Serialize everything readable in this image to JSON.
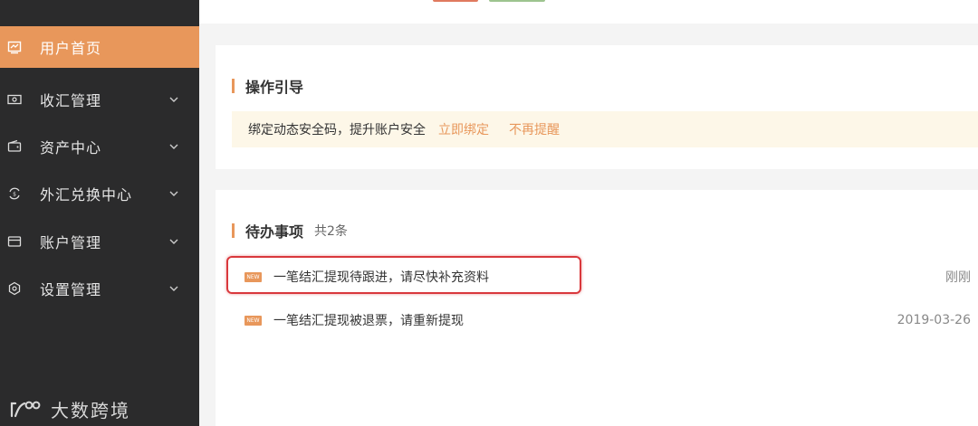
{
  "sidebar": {
    "items": [
      {
        "label": "用户首页",
        "icon": "chart-icon",
        "active": true
      },
      {
        "label": "收汇管理",
        "icon": "money-icon"
      },
      {
        "label": "资产中心",
        "icon": "wallet-icon"
      },
      {
        "label": "外汇兑换中心",
        "icon": "exchange-icon"
      },
      {
        "label": "账户管理",
        "icon": "card-icon"
      },
      {
        "label": "设置管理",
        "icon": "gear-icon"
      }
    ],
    "brand": {
      "logo": "1688-logo",
      "text": "大数跨境"
    }
  },
  "guide": {
    "title": "操作引导",
    "notice_text": "绑定动态安全码，提升账户安全",
    "bind_link": "立即绑定",
    "dismiss_link": "不再提醒"
  },
  "todo": {
    "title": "待办事项",
    "count": "共2条",
    "items": [
      {
        "badge": "NEW",
        "text": "一笔结汇提现待跟进，请尽快补充资料",
        "time": "刚刚"
      },
      {
        "badge": "NEW",
        "text": "一笔结汇提现被退票，请重新提现",
        "time": "2019-03-26"
      }
    ]
  },
  "colors": {
    "accent": "#e8975b",
    "sidebar_bg": "#2b2b2c",
    "highlight": "#d9383c",
    "notice_bg": "#fdf7e8"
  }
}
